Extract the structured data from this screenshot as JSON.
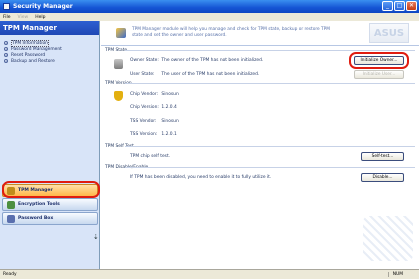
{
  "window": {
    "title": "Security Manager",
    "buttons": [
      "_",
      "□",
      "✕"
    ]
  },
  "menu": [
    "File",
    "View",
    "Help"
  ],
  "sidebar": {
    "header": "TPM Manager",
    "items": [
      {
        "label": "TPM Information"
      },
      {
        "label": "Password Management"
      },
      {
        "label": "Reset Password"
      },
      {
        "label": "Backup and Restore"
      }
    ],
    "buttons": [
      {
        "label": "TPM Manager"
      },
      {
        "label": "Encryption Tools"
      },
      {
        "label": "Password Box"
      }
    ],
    "more": "⇣"
  },
  "banner": {
    "text": "TPM Manager module will help you manage and check for TPM state, backup or restore TPM state and set the owner and user password.",
    "logo": "ASUS"
  },
  "sections": {
    "state": "TPM State",
    "version": "TPM Version",
    "selftest": "TPM Self Test",
    "disable": "TPM Disable/Enable"
  },
  "state": {
    "owner_label": "Owner State:",
    "owner_text": "The owner of the TPM has not been initialized.",
    "owner_btn": "Initialize Owner...",
    "user_label": "User State:",
    "user_text": "The user of the TPM has not been initialized.",
    "user_btn": "Initialize User..."
  },
  "version": {
    "rows": [
      {
        "label": "Chip Vendor:",
        "value": "Sinosun"
      },
      {
        "label": "Chip Version:",
        "value": "1.2.0.4"
      },
      {
        "label": "TSS Vendor:",
        "value": "Sinosun"
      },
      {
        "label": "TSS Version:",
        "value": "1.2.0.1"
      }
    ]
  },
  "selftest": {
    "text": "TPM chip self test.",
    "btn": "Self-test..."
  },
  "disable": {
    "text": "If TPM has been disabled, you need to enable it to fully utilize it.",
    "btn": "Disable..."
  },
  "statusbar": {
    "left": "Ready",
    "right": "NUM"
  }
}
